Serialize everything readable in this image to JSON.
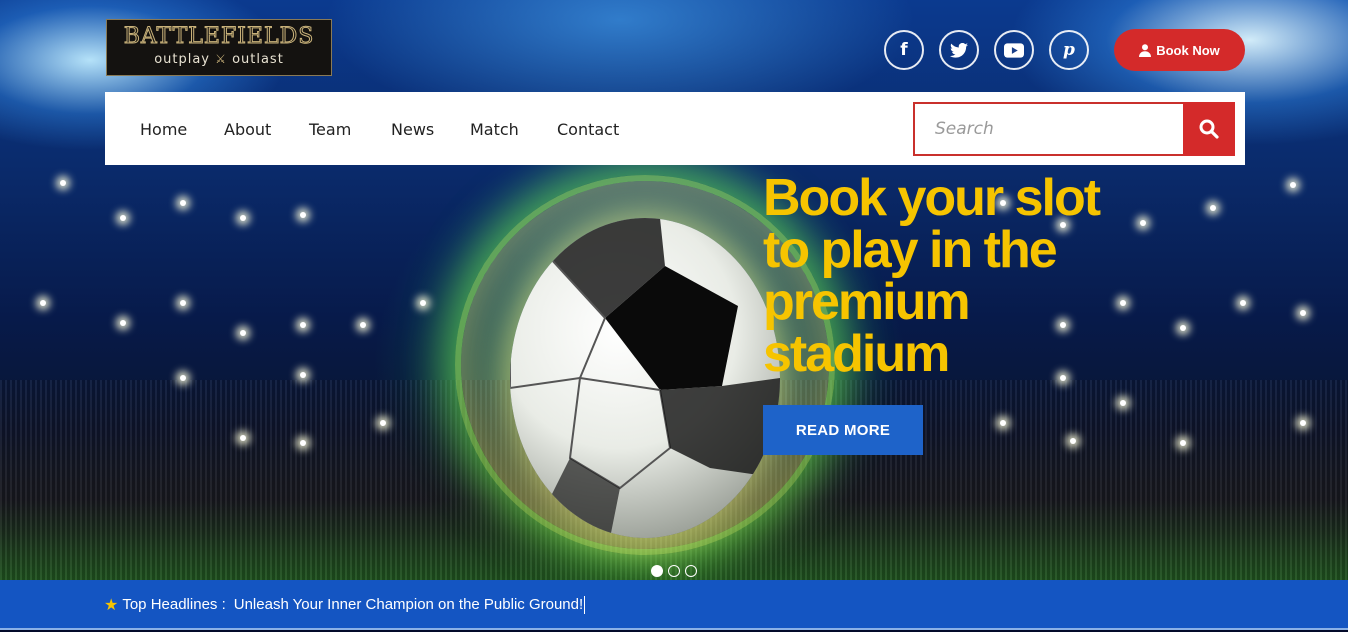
{
  "logo": {
    "title": "BATTLEFIELDS",
    "tagline_left": "outplay",
    "tagline_right": "outlast",
    "swords_icon": "crossed-swords-icon"
  },
  "social": [
    {
      "name": "facebook-icon",
      "glyph": "f"
    },
    {
      "name": "twitter-icon",
      "glyph": "t"
    },
    {
      "name": "youtube-icon",
      "glyph": "▶"
    },
    {
      "name": "pinterest-icon",
      "glyph": "p"
    }
  ],
  "header": {
    "book_label": "Book Now",
    "book_icon": "user-icon"
  },
  "nav": {
    "items": [
      "Home",
      "About",
      "Team",
      "News",
      "Match",
      "Contact"
    ]
  },
  "search": {
    "placeholder": "Search",
    "icon": "search-icon"
  },
  "hero": {
    "headline_line1": "Book your slot",
    "headline_line2": "to play in the",
    "headline_line3": "premium",
    "headline_line4": "stadium",
    "cta_label": "READ MORE",
    "slide_count": 3,
    "active_slide": 1
  },
  "ticker": {
    "label": "Top Headlines :",
    "text": "Unleash Your Inner Champion on the Public Ground!"
  },
  "colors": {
    "accent_red": "#d42a2a",
    "headline_yellow": "#f6c400",
    "ticker_blue": "#1455c2",
    "cta_blue": "#1e63c9"
  }
}
